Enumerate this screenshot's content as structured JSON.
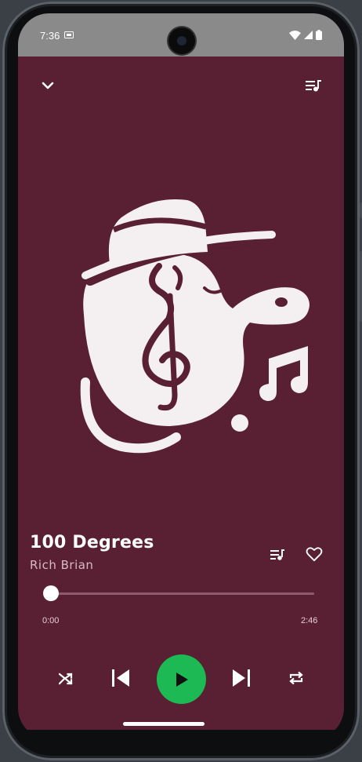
{
  "status_bar": {
    "time": "7:36"
  },
  "player": {
    "track_title": "100 Degrees",
    "artist": "Rich Brian",
    "current_time": "0:00",
    "duration": "2:46",
    "progress": 0.0
  },
  "colors": {
    "background": "#591f33",
    "accent": "#1db954",
    "text": "#ffffff"
  },
  "icons": {
    "collapse": "chevron-down-icon",
    "queue": "queue-music-icon",
    "add_to_playlist": "playlist-add-icon",
    "like": "heart-outline-icon",
    "shuffle": "shuffle-icon",
    "previous": "skip-previous-icon",
    "play": "play-icon",
    "next": "skip-next-icon",
    "repeat": "repeat-icon"
  }
}
